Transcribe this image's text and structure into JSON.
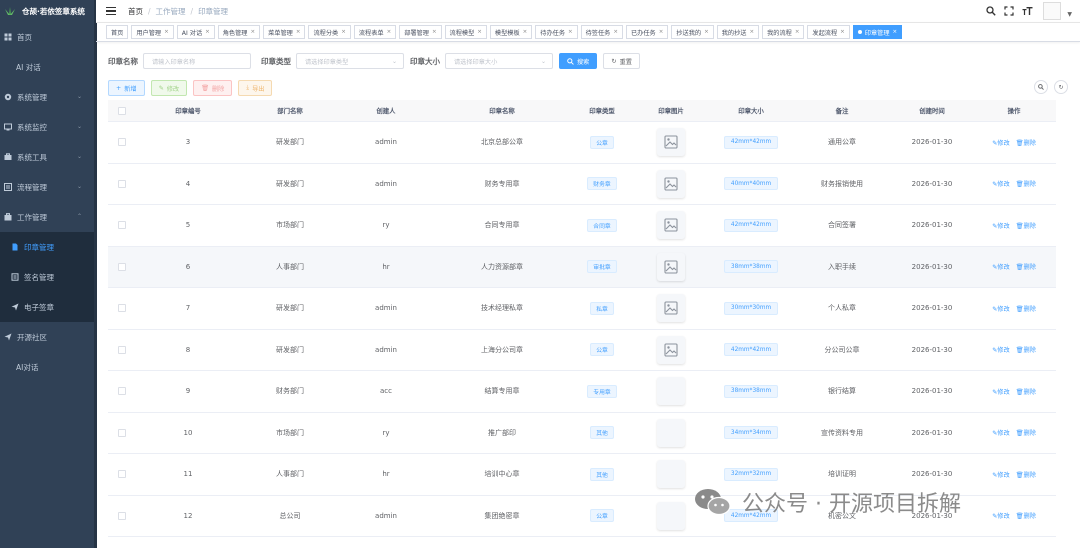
{
  "app": {
    "title": "仓颉·若依签章系统"
  },
  "sidebar": {
    "items": [
      {
        "label": "首页",
        "icon": "dashboard-icon",
        "kind": "top"
      },
      {
        "label": "AI 对话",
        "icon": "",
        "kind": "plain"
      },
      {
        "label": "系统管理",
        "icon": "gear-icon",
        "kind": "top",
        "caret": true
      },
      {
        "label": "系统监控",
        "icon": "monitor-icon",
        "kind": "top",
        "caret": true
      },
      {
        "label": "系统工具",
        "icon": "tool-icon",
        "kind": "top",
        "caret": true
      },
      {
        "label": "流程管理",
        "icon": "flow-icon",
        "kind": "top",
        "caret": true
      },
      {
        "label": "工作管理",
        "icon": "briefcase-icon",
        "kind": "top",
        "caret": true,
        "expanded": true
      },
      {
        "label": "印章管理",
        "icon": "document-icon",
        "kind": "sub",
        "active": true
      },
      {
        "label": "签名管理",
        "icon": "signature-icon",
        "kind": "sub"
      },
      {
        "label": "电子签章",
        "icon": "send-icon",
        "kind": "sub"
      },
      {
        "label": "开源社区",
        "icon": "send-icon",
        "kind": "top"
      },
      {
        "label": "AI对话",
        "icon": "",
        "kind": "plain"
      }
    ]
  },
  "breadcrumb": [
    "首页",
    "工作管理",
    "印章管理"
  ],
  "tags": [
    {
      "label": "首页",
      "closable": false
    },
    {
      "label": "用户管理",
      "closable": true
    },
    {
      "label": "AI 对话",
      "closable": true
    },
    {
      "label": "角色管理",
      "closable": true
    },
    {
      "label": "菜单管理",
      "closable": true
    },
    {
      "label": "流程分类",
      "closable": true
    },
    {
      "label": "流程表单",
      "closable": true
    },
    {
      "label": "部署管理",
      "closable": true
    },
    {
      "label": "流程模型",
      "closable": true
    },
    {
      "label": "模型模板",
      "closable": true
    },
    {
      "label": "待办任务",
      "closable": true
    },
    {
      "label": "待签任务",
      "closable": true
    },
    {
      "label": "已办任务",
      "closable": true
    },
    {
      "label": "抄送我的",
      "closable": true
    },
    {
      "label": "我的抄送",
      "closable": true
    },
    {
      "label": "我的流程",
      "closable": true
    },
    {
      "label": "发起流程",
      "closable": true
    },
    {
      "label": "印章管理",
      "closable": true,
      "active": true
    }
  ],
  "search": {
    "name_label": "印章名称",
    "name_placeholder": "请输入印章名称",
    "type_label": "印章类型",
    "type_placeholder": "请选择印章类型",
    "size_label": "印章大小",
    "size_placeholder": "请选择印章大小",
    "search_btn": "搜索",
    "reset_btn": "重置"
  },
  "toolbar": {
    "add": "新增",
    "edit": "修改",
    "delete": "删除",
    "export": "导出"
  },
  "table": {
    "headers": [
      "印章编号",
      "部门名称",
      "创建人",
      "印章名称",
      "印章类型",
      "印章图片",
      "印章大小",
      "备注",
      "创建时间",
      "操作"
    ],
    "edit_label": "修改",
    "delete_label": "删除",
    "rows": [
      {
        "id": "3",
        "dept": "研发部门",
        "creator": "admin",
        "name": "北京总部公章",
        "type": "公章",
        "has_img": true,
        "size": "42mm*42mm",
        "remark": "通用公章",
        "time": "2026-01-30"
      },
      {
        "id": "4",
        "dept": "研发部门",
        "creator": "admin",
        "name": "财务专用章",
        "type": "财务章",
        "has_img": true,
        "size": "40mm*40mm",
        "remark": "财务报销使用",
        "time": "2026-01-30"
      },
      {
        "id": "5",
        "dept": "市场部门",
        "creator": "ry",
        "name": "合同专用章",
        "type": "合同章",
        "has_img": true,
        "size": "42mm*42mm",
        "remark": "合同签署",
        "time": "2026-01-30"
      },
      {
        "id": "6",
        "dept": "人事部门",
        "creator": "hr",
        "name": "人力资源部章",
        "type": "审批章",
        "has_img": true,
        "size": "38mm*38mm",
        "remark": "入职手续",
        "time": "2026-01-30"
      },
      {
        "id": "7",
        "dept": "研发部门",
        "creator": "admin",
        "name": "技术经理私章",
        "type": "私章",
        "has_img": true,
        "size": "30mm*30mm",
        "remark": "个人私章",
        "time": "2026-01-30"
      },
      {
        "id": "8",
        "dept": "研发部门",
        "creator": "admin",
        "name": "上海分公司章",
        "type": "公章",
        "has_img": true,
        "size": "42mm*42mm",
        "remark": "分公司公章",
        "time": "2026-01-30"
      },
      {
        "id": "9",
        "dept": "财务部门",
        "creator": "acc",
        "name": "结算专用章",
        "type": "专用章",
        "has_img": false,
        "size": "38mm*38mm",
        "remark": "银行结算",
        "time": "2026-01-30"
      },
      {
        "id": "10",
        "dept": "市场部门",
        "creator": "ry",
        "name": "推广部印",
        "type": "其他",
        "has_img": false,
        "size": "34mm*34mm",
        "remark": "宣传资料专用",
        "time": "2026-01-30"
      },
      {
        "id": "11",
        "dept": "人事部门",
        "creator": "hr",
        "name": "培训中心章",
        "type": "其他",
        "has_img": false,
        "size": "32mm*32mm",
        "remark": "培训证明",
        "time": "2026-01-30"
      },
      {
        "id": "12",
        "dept": "总公司",
        "creator": "admin",
        "name": "集团绝密章",
        "type": "公章",
        "has_img": false,
        "size": "42mm*42mm",
        "remark": "机密公文",
        "time": "2026-01-30"
      }
    ]
  },
  "watermark": {
    "text": "公众号 · 开源项目拆解"
  }
}
